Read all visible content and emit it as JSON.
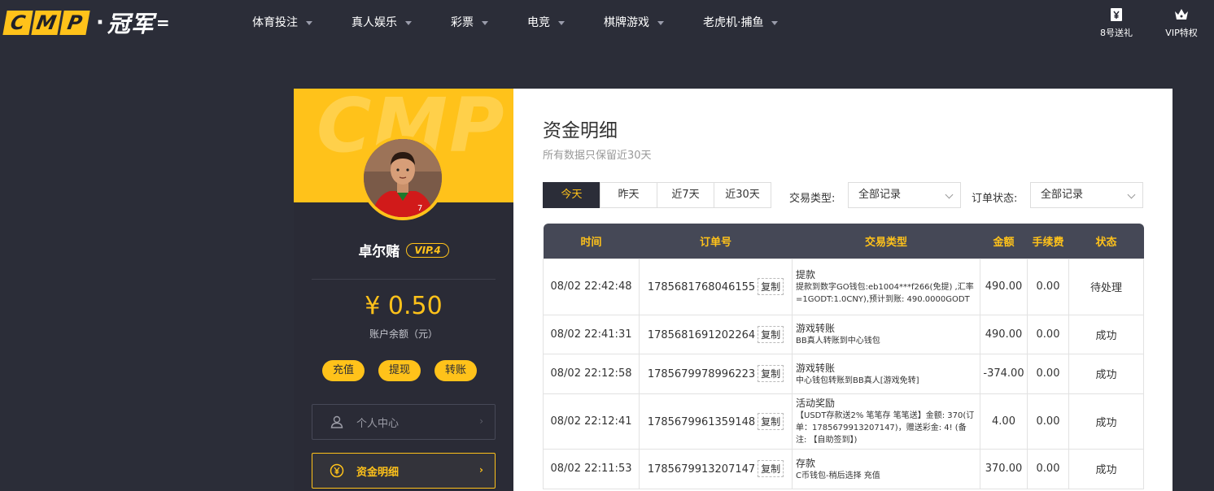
{
  "brand": {
    "logo_letters": [
      "C",
      "M",
      "P"
    ],
    "logo_dot": "·",
    "logo_cn": "冠军",
    "logo_tail": "="
  },
  "nav": {
    "items": [
      {
        "label": "体育投注"
      },
      {
        "label": "真人娱乐"
      },
      {
        "label": "彩票"
      },
      {
        "label": "电竞"
      },
      {
        "label": "棋牌游戏"
      },
      {
        "label": "老虎机·捕鱼"
      }
    ],
    "right": [
      {
        "label": "8号送礼",
        "icon": "gift-icon"
      },
      {
        "label": "VIP特权",
        "icon": "crown-icon"
      }
    ]
  },
  "sidebar": {
    "watermark": "CMP",
    "username": "卓尔赌",
    "vip": "VIP.4",
    "balance": "¥ 0.50",
    "balance_label": "账户余额（元）",
    "actions": [
      "充值",
      "提现",
      "转账"
    ],
    "menu": [
      {
        "label": "个人中心",
        "icon": "user-icon",
        "active": false
      },
      {
        "label": "资金明细",
        "icon": "yen-coin-icon",
        "active": true
      }
    ]
  },
  "main": {
    "title": "资金明细",
    "subtitle": "所有数据只保留近30天",
    "date_tabs": [
      {
        "label": "今天",
        "active": true
      },
      {
        "label": "昨天",
        "active": false
      },
      {
        "label": "近7天",
        "active": false
      },
      {
        "label": "近30天",
        "active": false
      }
    ],
    "filters": {
      "type_label": "交易类型:",
      "type_value": "全部记录",
      "status_label": "订单状态:",
      "status_value": "全部记录"
    },
    "table": {
      "headers": [
        "时间",
        "订单号",
        "交易类型",
        "金额",
        "手续费",
        "状态"
      ],
      "copy_label": "复制",
      "rows": [
        {
          "time": "08/02 22:42:48",
          "order": "1785681768046155",
          "type": "提款",
          "detail": "提款到数字GO钱包:eb1004***f266(免提) ,汇率=1GODT:1.0CNY),预计到账: 490.0000GODT",
          "amount": "490.00",
          "fee": "0.00",
          "status": "待处理",
          "status_kind": "pending"
        },
        {
          "time": "08/02 22:41:31",
          "order": "1785681691202264",
          "type": "游戏转账",
          "detail": "BB真人转账到中心钱包",
          "amount": "490.00",
          "fee": "0.00",
          "status": "成功",
          "status_kind": "success"
        },
        {
          "time": "08/02 22:12:58",
          "order": "1785679978996223",
          "type": "游戏转账",
          "detail": "中心钱包转账到BB真人[游戏免转]",
          "amount": "-374.00",
          "fee": "0.00",
          "status": "成功",
          "status_kind": "success"
        },
        {
          "time": "08/02 22:12:41",
          "order": "1785679961359148",
          "type": "活动奖励",
          "detail": "【USDT存款送2% 笔笔存 笔笔送】金额: 370(订单：1785679913207147)，赠送彩金: 4!  (备注: 【自助签到】)",
          "amount": "4.00",
          "fee": "0.00",
          "status": "成功",
          "status_kind": "success"
        },
        {
          "time": "08/02 22:11:53",
          "order": "1785679913207147",
          "type": "存款",
          "detail": "C币钱包-稍后选择 充值",
          "amount": "370.00",
          "fee": "0.00",
          "status": "成功",
          "status_kind": "success"
        }
      ]
    }
  },
  "colors": {
    "accent": "#ffc21a",
    "dark": "#2b2d38",
    "success": "#3a9a3a",
    "table_head": "#454856"
  }
}
